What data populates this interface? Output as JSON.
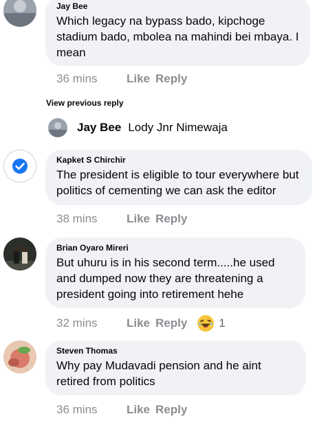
{
  "comments": [
    {
      "author": "Jay Bee",
      "text": "Which legacy na bypass bado,  kipchoge stadium bado, mbolea na mahindi bei mbaya. I mean",
      "time": "36 mins",
      "like": "Like",
      "reply": "Reply"
    },
    {
      "author": "Kapket S Chirchir",
      "text": "The president is eligible to tour everywhere but politics of cementing we can ask the editor",
      "time": "38 mins",
      "like": "Like",
      "reply": "Reply"
    },
    {
      "author": "Brian Oyaro Mireri",
      "text": "But uhuru is in his second term.....he used and dumped now they are threatening a president going into retirement hehe",
      "time": "32 mins",
      "like": "Like",
      "reply": "Reply",
      "reaction_count": "1",
      "reaction_icon": "laughing-emoji"
    },
    {
      "author": "Steven Thomas",
      "text": "Why pay Mudavadi pension and he aint retired from politics",
      "time": "36 mins",
      "like": "Like",
      "reply": "Reply"
    }
  ],
  "view_previous": "View previous reply",
  "reply_preview": {
    "author": "Jay Bee",
    "text": "Lody Jnr Nimewaja"
  },
  "colors": {
    "bubble": "#f0f2f5",
    "meta": "#8a8d91",
    "verified_blue": "#1877f2"
  }
}
